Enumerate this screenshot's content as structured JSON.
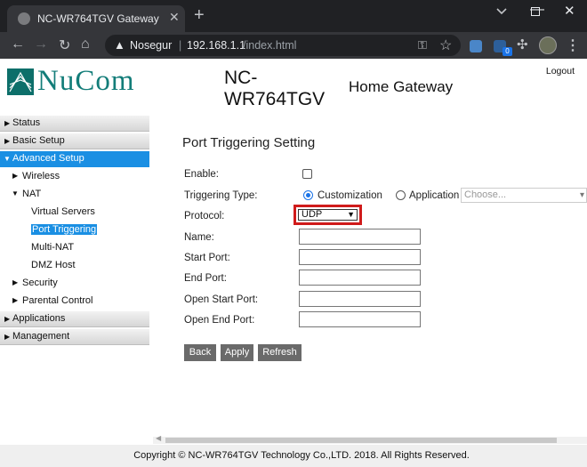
{
  "browser": {
    "tab_title": "NC-WR764TGV Gateway",
    "tab_close": "✕",
    "new_tab": "+",
    "chevron": "⌄",
    "url_warning": "Nosegur",
    "url_separator": "|",
    "url_host": "192.168.1.1",
    "url_path": "/index.html",
    "extension_badge": "0",
    "icons": [
      "back-arrow-icon",
      "forward-arrow-icon",
      "reload-icon",
      "home-icon",
      "warning-icon",
      "key-icon",
      "star-icon",
      "puzzle-icon",
      "kebab-menu-icon"
    ]
  },
  "header": {
    "logo_text": "NuCom",
    "model": "NC-WR764TGV",
    "product": "Home Gateway",
    "logout": "Logout"
  },
  "sidebar": {
    "status": "Status",
    "basic_setup": "Basic Setup",
    "advanced_setup": "Advanced Setup",
    "wireless": "Wireless",
    "nat": "NAT",
    "virtual_servers": "Virtual Servers",
    "port_triggering": "Port Triggering",
    "multi_nat": "Multi-NAT",
    "dmz_host": "DMZ Host",
    "security": "Security",
    "parental_control": "Parental Control",
    "applications": "Applications",
    "management": "Management"
  },
  "form": {
    "heading": "Port Triggering Setting",
    "enable_label": "Enable:",
    "triggering_type_label": "Triggering Type:",
    "customization": "Customization",
    "application": "Application",
    "choose_placeholder": "Choose...",
    "protocol_label": "Protocol:",
    "protocol_value": "UDP",
    "name_label": "Name:",
    "start_port_label": "Start Port:",
    "end_port_label": "End Port:",
    "open_start_port_label": "Open Start Port:",
    "open_end_port_label": "Open End Port:",
    "triggering_type_selected": "Customization",
    "enable_checked": false
  },
  "buttons": {
    "back": "Back",
    "apply": "Apply",
    "refresh": "Refresh"
  },
  "footer": {
    "copyright": "Copyright © NC-WR764TGV Technology Co.,LTD. 2018. All Rights Reserved."
  },
  "colors": {
    "accent_blue": "#1a8fe3",
    "logo_teal": "#137d79",
    "highlight_red": "#d01b1b"
  }
}
